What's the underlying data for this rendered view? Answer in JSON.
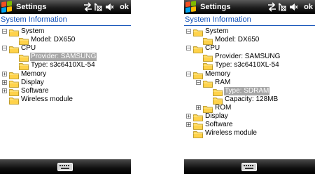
{
  "screens": [
    {
      "title": "Settings",
      "ok_label": "ok",
      "heading": "System Information",
      "rows": [
        {
          "label": "System",
          "depth": 0,
          "expander": "−",
          "selected": false
        },
        {
          "label": "Model: DX650",
          "depth": 1,
          "expander": "",
          "selected": false
        },
        {
          "label": "CPU",
          "depth": 0,
          "expander": "−",
          "selected": false
        },
        {
          "label": "Provider: SAMSUNG",
          "depth": 1,
          "expander": "",
          "selected": true
        },
        {
          "label": "Type: s3c6410XL-54",
          "depth": 1,
          "expander": "",
          "selected": false
        },
        {
          "label": "Memory",
          "depth": 0,
          "expander": "+",
          "selected": false
        },
        {
          "label": "Display",
          "depth": 0,
          "expander": "+",
          "selected": false
        },
        {
          "label": "Software",
          "depth": 0,
          "expander": "+",
          "selected": false
        },
        {
          "label": "Wireless module",
          "depth": 0,
          "expander": "",
          "selected": false
        }
      ]
    },
    {
      "title": "Settings",
      "ok_label": "ok",
      "heading": "System Information",
      "rows": [
        {
          "label": "System",
          "depth": 0,
          "expander": "−",
          "selected": false
        },
        {
          "label": "Model: DX650",
          "depth": 1,
          "expander": "",
          "selected": false
        },
        {
          "label": "CPU",
          "depth": 0,
          "expander": "−",
          "selected": false
        },
        {
          "label": "Provider: SAMSUNG",
          "depth": 1,
          "expander": "",
          "selected": false
        },
        {
          "label": "Type: s3c6410XL-54",
          "depth": 1,
          "expander": "",
          "selected": false
        },
        {
          "label": "Memory",
          "depth": 0,
          "expander": "−",
          "selected": false
        },
        {
          "label": "RAM",
          "depth": 1,
          "expander": "−",
          "selected": false
        },
        {
          "label": "Type: SDRAM",
          "depth": 2,
          "expander": "",
          "selected": true
        },
        {
          "label": "Capacity: 128MB",
          "depth": 2,
          "expander": "",
          "selected": false
        },
        {
          "label": "ROM",
          "depth": 1,
          "expander": "+",
          "selected": false
        },
        {
          "label": "Display",
          "depth": 0,
          "expander": "+",
          "selected": false
        },
        {
          "label": "Software",
          "depth": 0,
          "expander": "+",
          "selected": false
        },
        {
          "label": "Wireless module",
          "depth": 0,
          "expander": "",
          "selected": false
        }
      ]
    }
  ],
  "icons": {
    "start": "windows-start-icon",
    "connectivity": "sync-arrows-icon",
    "signal": "signal-off-icon",
    "volume": "speaker-muted-icon",
    "folder": "folder-icon",
    "keyboard": "keyboard-icon"
  },
  "colors": {
    "heading": "#1050b8",
    "selection": "#a6a6a6",
    "folder": "#ffd24a"
  }
}
